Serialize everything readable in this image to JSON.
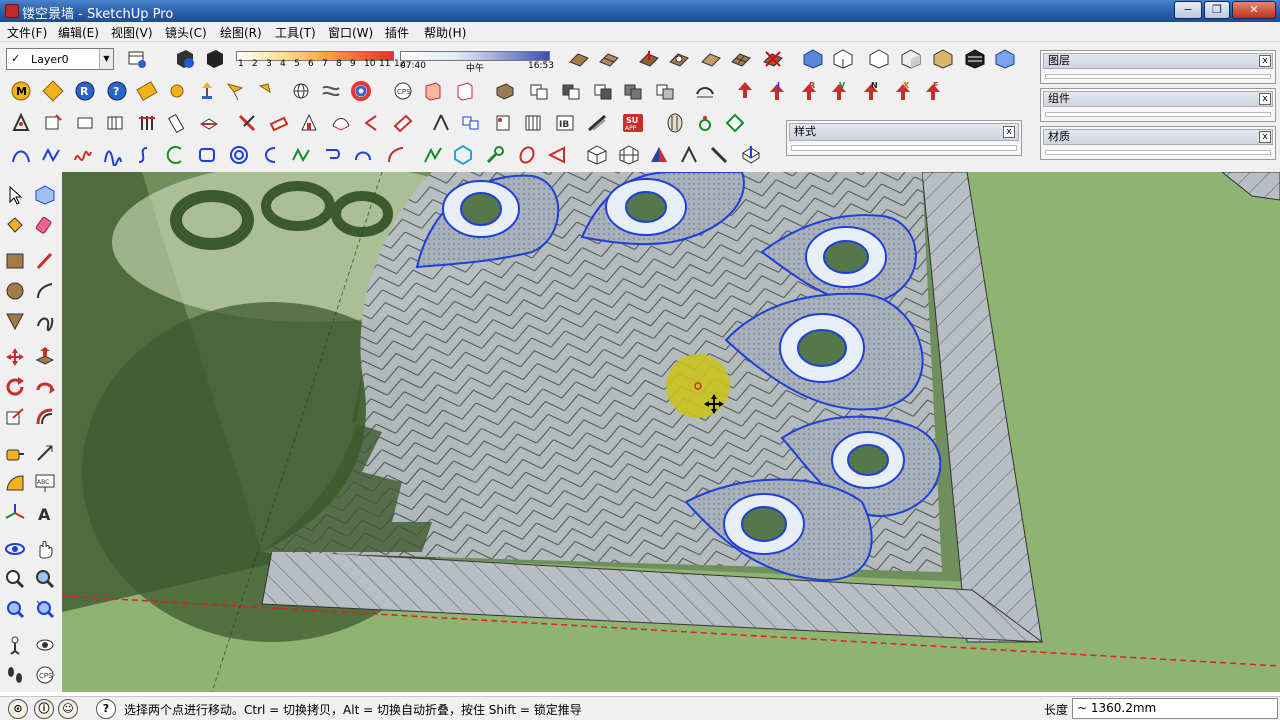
{
  "window": {
    "title": "镂空景墙 - SketchUp Pro",
    "controls": {
      "minimize": "−",
      "restore": "❐",
      "close": "✕"
    }
  },
  "menu": [
    "文件(F)",
    "编辑(E)",
    "视图(V)",
    "镜头(C)",
    "绘图(R)",
    "工具(T)",
    "窗口(W)",
    "插件",
    "帮助(H)"
  ],
  "layers_toolbar": {
    "current_layer": "Layer0",
    "check": "✓",
    "drop": "▼"
  },
  "shadows_toolbar": {
    "month_ticks": [
      "1",
      "2",
      "3",
      "4",
      "5",
      "6",
      "7",
      "8",
      "9",
      "10",
      "11",
      "12"
    ],
    "time_start": "07:40",
    "time_mid": "中午",
    "time_end": "16:53"
  },
  "tray": {
    "panels": [
      {
        "title": "图层",
        "close": "x"
      },
      {
        "title": "组件",
        "close": "x"
      },
      {
        "title": "材质",
        "close": "x"
      }
    ]
  },
  "style_panel": {
    "title": "样式",
    "close": "x"
  },
  "status": {
    "hint": "选择两个点进行移动。Ctrl = 切换拷贝，Alt = 切换自动折叠，按住 Shift = 锁定推导",
    "measure_label": "长度",
    "measure_value": "~ 1360.2mm",
    "help_icon": "?"
  },
  "colors": {
    "accent_blue": "#1f3fd8",
    "ground": "#8fb371",
    "axis_red": "#e02020",
    "cursor_yellow": "#c8c21c"
  }
}
